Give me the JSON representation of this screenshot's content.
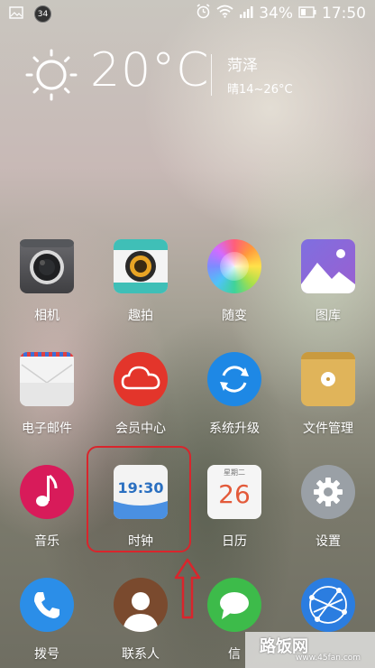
{
  "status": {
    "notification_count": "34",
    "battery": "34%",
    "time": "17:50"
  },
  "weather": {
    "temperature": "20°C",
    "city": "菏泽",
    "range": "晴14~26°C"
  },
  "apps": {
    "camera": "相机",
    "quickshot": "趣拍",
    "suibian": "随变",
    "gallery": "图库",
    "email": "电子邮件",
    "member": "会员中心",
    "update": "系统升级",
    "files": "文件管理",
    "music": "音乐",
    "clock": "时钟",
    "calendar": "日历",
    "settings": "设置"
  },
  "clock_icon": {
    "time": "19:30"
  },
  "calendar_icon": {
    "weekday": "星期二",
    "day": "26"
  },
  "dock": {
    "dialer": "拨号",
    "contacts": "联系人",
    "messages": "信"
  },
  "watermark": {
    "main": "路饭网",
    "url": "www.45fan.com"
  }
}
